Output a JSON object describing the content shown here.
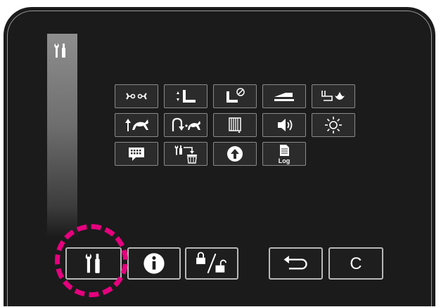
{
  "theme": {
    "panel_bg": "#1b1b1b",
    "tile_bg": "#2b2b2b",
    "tile_border": "#8a8a8a",
    "icon_color": "#ffffff",
    "highlight_color": "#e5007e"
  },
  "sidebar": {
    "icon": "tools-icon"
  },
  "grid": {
    "rows": [
      [
        "thread-trimmer-icon",
        "presser-foot-lift-icon",
        "presser-foot-lock-icon",
        "bed-stitch-icon",
        "needle-light-icon"
      ],
      [
        "speed-up-icon",
        "reverse-speed-icon",
        "bobbin-counter-icon",
        "volume-icon",
        "brightness-icon"
      ],
      [
        "keyboard-icon",
        "reset-settings-icon",
        "upload-icon",
        "log-icon"
      ]
    ],
    "log_text": "Log"
  },
  "bottom_bar": {
    "buttons": [
      "tools-button",
      "info-button",
      "lock-unlock-button",
      "back-button",
      "clear-button"
    ],
    "clear_label": "C",
    "highlighted": "tools-button"
  }
}
